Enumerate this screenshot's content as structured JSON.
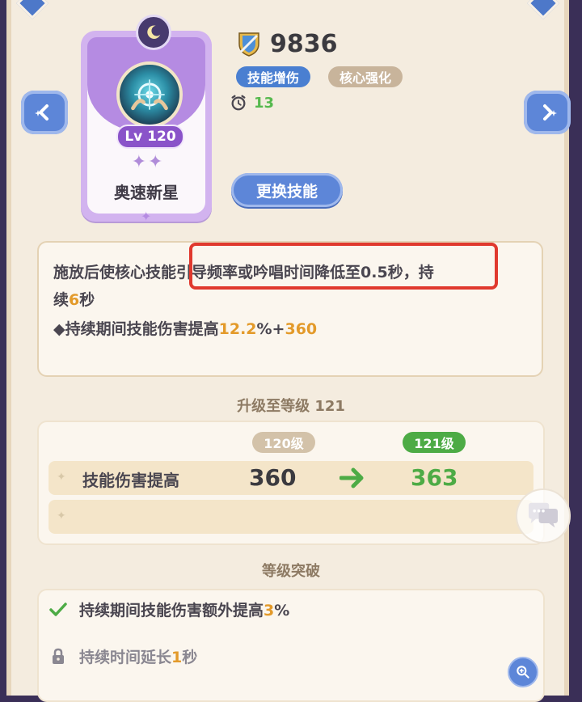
{
  "skill": {
    "level_label": "Lv 120",
    "name": "奥速新星"
  },
  "power": {
    "value": "9836"
  },
  "tags": [
    "技能增伤",
    "核心强化"
  ],
  "cooldown": {
    "value": "13"
  },
  "buttons": {
    "change_skill": "更换技能"
  },
  "description": {
    "line1_prefix": "施放后使核心技",
    "line1_hidden": "能",
    "line1_highlight": "引导频率或吟唱时间降低至0.5秒，",
    "line1_suffix": "持",
    "line2_prefix": "续",
    "line2_value": "6",
    "line2_suffix": "秒",
    "line3_prefix": "◆持续期间技能伤害提高",
    "line3_value1": "12.2",
    "line3_mid": "%+",
    "line3_value2": "360"
  },
  "upgrade": {
    "title": "升级至等级 121",
    "current_level": "120级",
    "next_level": "121级",
    "rows": [
      {
        "label": "技能伤害提高",
        "current": "360",
        "next": "363"
      },
      {
        "label": "",
        "current": "",
        "next": ""
      }
    ]
  },
  "breakthrough": {
    "title": "等级突破",
    "items": [
      {
        "text_prefix": "持续期间技能伤害额外提高",
        "value": "3",
        "suffix": "%",
        "status": "unlocked"
      },
      {
        "text_prefix": "持续时间延长",
        "value": "1",
        "suffix": "秒",
        "status": "locked"
      }
    ]
  },
  "colors": {
    "accent_blue": "#5d86d8",
    "green": "#4dab45",
    "orange": "#e39a2a",
    "highlight_red": "#e0392e"
  }
}
